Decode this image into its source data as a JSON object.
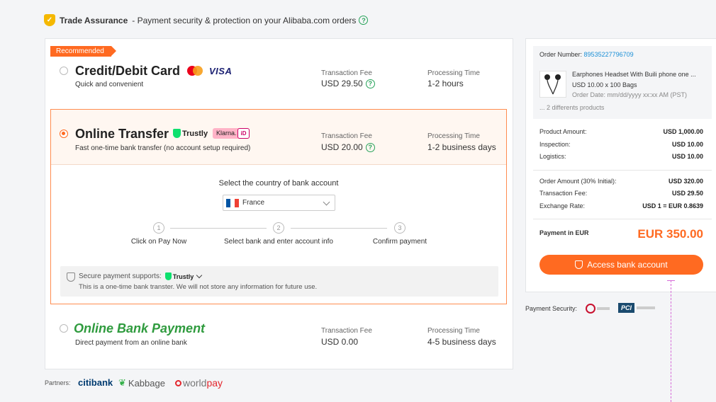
{
  "trade_assurance": {
    "title": "Trade Assurance",
    "desc": "- Payment security & protection on your Alibaba.com orders",
    "help": "?"
  },
  "methods": {
    "badge": "Recommended",
    "card": {
      "title": "Credit/Debit Card",
      "subtitle": "Quick and convenient",
      "visa": "VISA",
      "fee_label": "Transaction Fee",
      "fee_value": "USD 29.50",
      "time_label": "Processing Time",
      "time_value": "1-2 hours"
    },
    "online_transfer": {
      "title": "Online Transfer",
      "subtitle": "Fast one-time bank transfer (no account setup required)",
      "trustly": "Trustly",
      "klarna": "Klarna.",
      "ideal": "iD",
      "fee_label": "Transaction Fee",
      "fee_value": "USD 20.00",
      "time_label": "Processing Time",
      "time_value": "1-2 business days",
      "country_prompt": "Select the country of bank account",
      "country": "France",
      "steps": [
        {
          "num": "1",
          "label": "Click on Pay Now"
        },
        {
          "num": "2",
          "label": "Select bank and enter account info"
        },
        {
          "num": "3",
          "label": "Confirm payment"
        }
      ],
      "secure_label": "Secure payment supports:",
      "secure_brand": "Trustly",
      "secure_note": "This is a one-time bank transter. We will not store any information for future use."
    },
    "online_bank": {
      "title": "Online Bank Payment",
      "subtitle": "Direct payment from an online bank",
      "fee_label": "Transaction Fee",
      "fee_value": "USD 0.00",
      "time_label": "Processing Time",
      "time_value": "4-5 business days"
    }
  },
  "partners": {
    "label": "Partners:",
    "citibank": "citibank",
    "kabbage": "Kabbage",
    "worldpay_a": "world",
    "worldpay_b": "pay"
  },
  "order": {
    "number_label": "Order Number:",
    "number": "89535227796709",
    "product_name": "Earphones Headset With Buili phone one ...",
    "product_qty": "USD 10.00 x 100 Bags",
    "order_date": "Order Date: mm/dd/yyyy xx:xx AM (PST)",
    "more": "... 2 differents products"
  },
  "summary": {
    "rows1": [
      {
        "label": "Product Amount:",
        "value": "USD 1,000.00"
      },
      {
        "label": "Inspection:",
        "value": "USD 10.00"
      },
      {
        "label": "Logistics:",
        "value": "USD 10.00"
      }
    ],
    "rows2": [
      {
        "label": "Order Amount (30% Initial):",
        "value": "USD 320.00"
      },
      {
        "label": "Transaction Fee:",
        "value": "USD 29.50"
      },
      {
        "label": "Exchange Rate:",
        "value": "USD 1 = EUR 0.8639"
      }
    ],
    "pay_label": "Payment in EUR",
    "pay_value": "EUR 350.00",
    "button": "Access bank account"
  },
  "security": {
    "label": "Payment Security:",
    "pci": "PCI"
  },
  "colors": {
    "accent": "#ff6a21",
    "green": "#27a35a",
    "link": "#1a8fd6"
  }
}
